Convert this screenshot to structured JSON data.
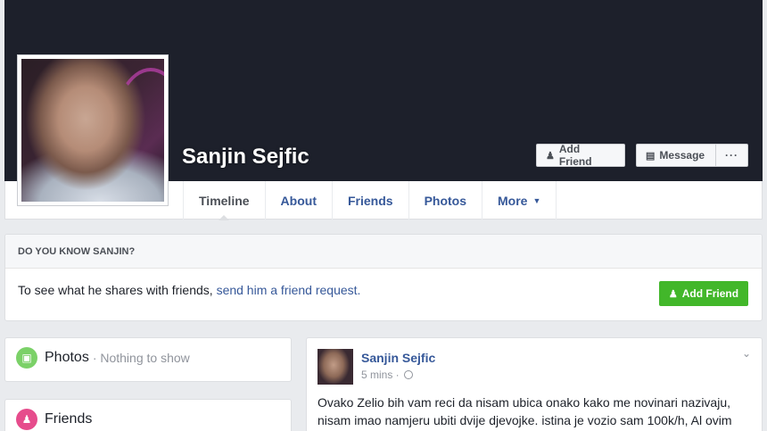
{
  "profile": {
    "name": "Sanjin Sejfic"
  },
  "cover_buttons": {
    "add_friend": "Add Friend",
    "message": "Message",
    "more": "···"
  },
  "tabs": [
    {
      "label": "Timeline",
      "active": true
    },
    {
      "label": "About"
    },
    {
      "label": "Friends"
    },
    {
      "label": "Photos"
    },
    {
      "label": "More"
    }
  ],
  "know_box": {
    "heading": "DO YOU KNOW SANJIN?",
    "text": "To see what he shares with friends, ",
    "link": "send him a friend request.",
    "button": "Add Friend"
  },
  "sidebar": {
    "photos": {
      "title": "Photos",
      "sub": "· Nothing to show"
    },
    "friends": {
      "title": "Friends"
    }
  },
  "post": {
    "author": "Sanjin Sejfic",
    "time": "5 mins · ",
    "text": "Ovako Zelio bih vam reci da nisam ubica onako kako me novinari nazivaju, nisam imao namjeru ubiti dvije djevojke. istina je vozio sam 100k/h, Al ovim"
  },
  "colors": {
    "cover": "#1d202b",
    "link": "#365899",
    "green": "#42b72a",
    "photos_icon": "#7bd168",
    "friends_icon": "#e64c8c"
  },
  "icons": [
    "add-friend-icon",
    "message-icon",
    "more-dots-icon",
    "caret-down-icon",
    "photos-icon",
    "friends-icon",
    "globe-icon",
    "chevron-down-icon"
  ]
}
